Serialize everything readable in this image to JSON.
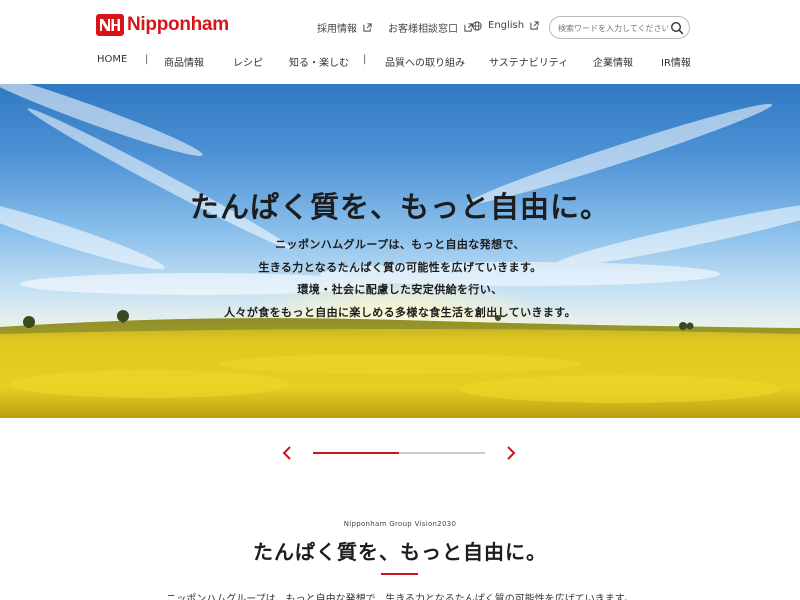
{
  "brand": {
    "logo_text": "Nipponham",
    "accent_color": "#c8161d"
  },
  "utility": [
    {
      "label": "採用情報",
      "icon": "external-link-icon"
    },
    {
      "label": "お客様相談窓口",
      "icon": "external-link-icon"
    },
    {
      "label": "English",
      "icon": "external-link-icon",
      "prefix_icon": "globe-icon"
    }
  ],
  "search": {
    "placeholder": "検索ワードを入力してください",
    "icon": "search-icon"
  },
  "nav": [
    {
      "label": "HOME"
    },
    {
      "label": "商品情報"
    },
    {
      "label": "レシピ"
    },
    {
      "label": "知る・楽しむ"
    },
    {
      "label": "品質への取り組み"
    },
    {
      "label": "サステナビリティ"
    },
    {
      "label": "企業情報"
    },
    {
      "label": "IR情報"
    }
  ],
  "hero": {
    "title": "たんぱく質を、もっと自由に。",
    "lines": [
      "ニッポンハムグループは、もっと自由な発想で、",
      "生きる力となるたんぱく質の可能性を広げていきます。",
      "環境・社会に配慮した安定供給を行い、",
      "人々が食をもっと自由に楽しめる多様な食生活を創出していきます。"
    ]
  },
  "slider": {
    "progress": 0.5,
    "prev_icon": "chevron-left-icon",
    "next_icon": "chevron-right-icon"
  },
  "vision": {
    "label": "Nipponham Group Vision2030",
    "title": "たんぱく質を、もっと自由に。",
    "body": "ニッポンハムグループは、もっと自由な発想で、生きる力となるたんぱく質の可能性を広げていきます。"
  }
}
